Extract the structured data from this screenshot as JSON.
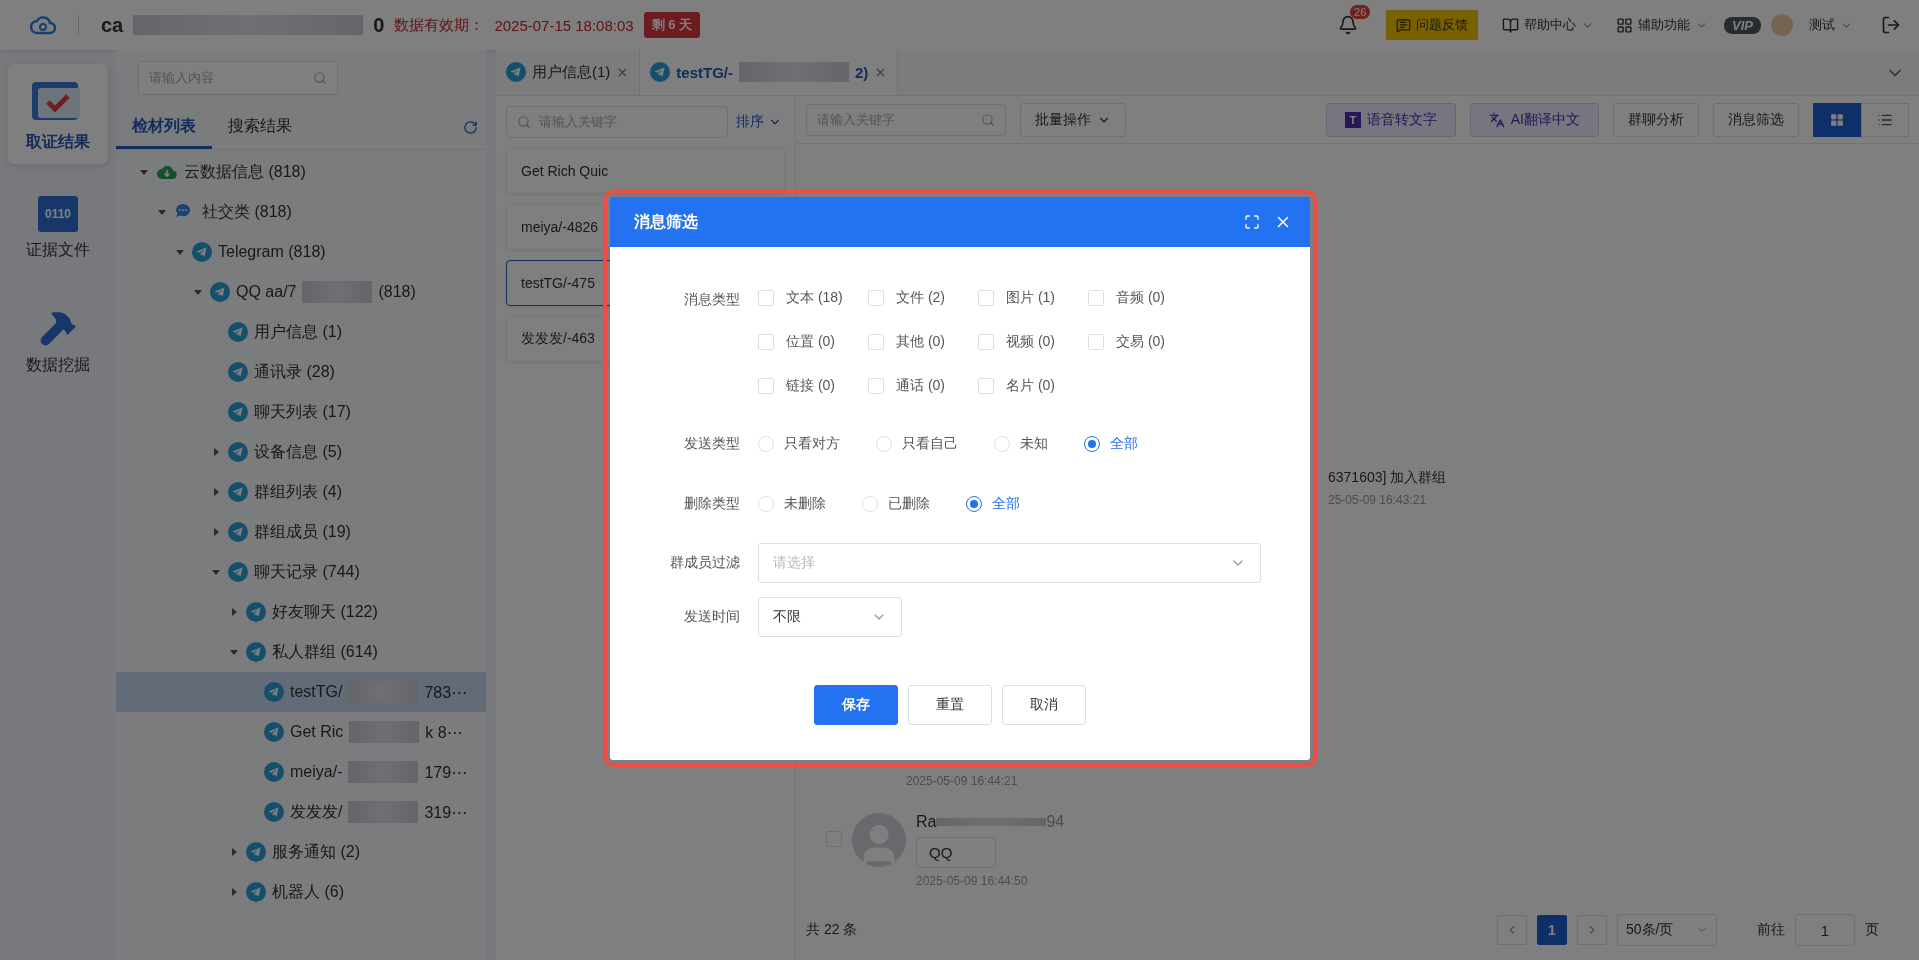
{
  "header": {
    "title": "ca",
    "title_end": "0",
    "validity_label": "数据有效期：",
    "validity_date": "2025-07-15 18:08:03",
    "remaining": "剩 6 天",
    "notifications": "26",
    "feedback": "问题反馈",
    "menus": [
      {
        "kind": "help",
        "label": "帮助中心"
      },
      {
        "kind": "tools",
        "label": "辅助功能"
      }
    ],
    "vip": "VIP",
    "user": "测试"
  },
  "nav": [
    {
      "kind": "folder",
      "label": "取证结果",
      "selected": true
    },
    {
      "kind": "file",
      "label": "证据文件",
      "icon_text": "0110",
      "selected": false
    },
    {
      "kind": "hammer",
      "label": "数据挖掘",
      "selected": false
    }
  ],
  "tree": {
    "search_placeholder": "请输入内容",
    "tabs": [
      {
        "label": "检材列表",
        "selected": true
      },
      {
        "label": "搜索结果",
        "selected": false
      }
    ],
    "items": [
      {
        "kind": "cloud",
        "label": "云数据信息 (818)",
        "expanded": true,
        "selected": false,
        "children": [
          {
            "kind": "chat",
            "label": "社交类 (818)",
            "expanded": true,
            "selected": false,
            "children": [
              {
                "kind": "telegram",
                "label": "Telegram (818)",
                "expanded": true,
                "selected": false,
                "children": [
                  {
                    "kind": "telegram",
                    "label": "QQ aa/7",
                    "suffix": "(818)",
                    "expanded": true,
                    "selected": false,
                    "children": [
                      {
                        "kind": "telegram",
                        "label": "用户信息 (1)",
                        "selected": false
                      },
                      {
                        "kind": "telegram",
                        "label": "通讯录 (28)",
                        "selected": false
                      },
                      {
                        "kind": "telegram",
                        "label": "聊天列表 (17)",
                        "selected": false
                      },
                      {
                        "kind": "telegram",
                        "label": "设备信息 (5)",
                        "expanded": false,
                        "selected": false
                      },
                      {
                        "kind": "telegram",
                        "label": "群组列表 (4)",
                        "expanded": false,
                        "selected": false
                      },
                      {
                        "kind": "telegram",
                        "label": "群组成员 (19)",
                        "expanded": false,
                        "selected": false
                      },
                      {
                        "kind": "telegram",
                        "label": "聊天记录 (744)",
                        "expanded": true,
                        "selected": false,
                        "children": [
                          {
                            "kind": "telegram",
                            "label": "好友聊天 (122)",
                            "expanded": false,
                            "selected": false
                          },
                          {
                            "kind": "telegram",
                            "label": "私人群组 (614)",
                            "expanded": true,
                            "selected": false,
                            "children": [
                              {
                                "kind": "telegram",
                                "label": "testTG/",
                                "suffix": "783⋯",
                                "selected": true
                              },
                              {
                                "kind": "telegram",
                                "label": "Get Ric",
                                "suffix": "k 8⋯",
                                "selected": false
                              },
                              {
                                "kind": "telegram",
                                "label": "meiya/-",
                                "suffix": "179⋯",
                                "selected": false
                              },
                              {
                                "kind": "telegram",
                                "label": "发发发/",
                                "suffix": "319⋯",
                                "selected": false
                              }
                            ]
                          },
                          {
                            "kind": "telegram",
                            "label": "服务通知 (2)",
                            "expanded": false,
                            "selected": false
                          },
                          {
                            "kind": "telegram",
                            "label": "机器人 (6)",
                            "expanded": false,
                            "selected": false
                          }
                        ]
                      }
                    ]
                  }
                ]
              }
            ]
          }
        ]
      }
    ]
  },
  "doc_tabs": [
    {
      "label": "用户信息(1)",
      "selected": false
    },
    {
      "label": "testTG/-",
      "suffix": "2)",
      "selected": true
    }
  ],
  "chat_list": {
    "search_placeholder": "请输入关键字",
    "sort": "排序",
    "items": [
      {
        "label": "Get Rich Quic",
        "selected": false
      },
      {
        "label": "meiya/-4826",
        "selected": false
      },
      {
        "label": "testTG/-475",
        "selected": true
      },
      {
        "label": "发发发/-463",
        "selected": false
      }
    ]
  },
  "messages": {
    "search_placeholder": "请输入关键字",
    "batch": "批量操作",
    "tools": [
      {
        "kind": "voice",
        "label": "语音转文字",
        "icon_text": "T"
      },
      {
        "kind": "translate",
        "label": "AI翻译中文"
      },
      {
        "kind": "plain",
        "label": "群聊分析"
      },
      {
        "kind": "plain",
        "label": "消息筛选"
      }
    ],
    "views": [
      {
        "kind": "grid",
        "selected": true
      },
      {
        "kind": "list",
        "selected": false
      }
    ],
    "items": [
      {
        "kind": "system",
        "text": "6371603] 加入群组",
        "time": "25-05-09 16:43:21"
      },
      {
        "kind": "time",
        "time": "2025-05-09 16:44:21"
      },
      {
        "kind": "message",
        "name": "Ra",
        "name_end": "94",
        "text": "QQ",
        "time": "2025-05-09 16:44:50",
        "checked": false
      }
    ],
    "total": "共 22 条",
    "pages": [
      {
        "label": "1",
        "selected": true
      }
    ],
    "page_size": "50条/页",
    "goto_label": "前往",
    "goto_value": "1",
    "page_unit": "页"
  },
  "dialog": {
    "title": "消息筛选",
    "message_types": {
      "label": "消息类型",
      "options": [
        {
          "label": "文本 (18)",
          "checked": false
        },
        {
          "label": "文件 (2)",
          "checked": false
        },
        {
          "label": "图片 (1)",
          "checked": false
        },
        {
          "label": "音频 (0)",
          "checked": false
        },
        {
          "label": "位置 (0)",
          "checked": false
        },
        {
          "label": "其他 (0)",
          "checked": false
        },
        {
          "label": "视频 (0)",
          "checked": false
        },
        {
          "label": "交易 (0)",
          "checked": false
        },
        {
          "label": "链接 (0)",
          "checked": false
        },
        {
          "label": "通话 (0)",
          "checked": false
        },
        {
          "label": "名片 (0)",
          "checked": false
        }
      ]
    },
    "send_type": {
      "label": "发送类型",
      "options": [
        {
          "label": "只看对方",
          "selected": false
        },
        {
          "label": "只看自己",
          "selected": false
        },
        {
          "label": "未知",
          "selected": false
        },
        {
          "label": "全部",
          "selected": true
        }
      ]
    },
    "delete_type": {
      "label": "删除类型",
      "options": [
        {
          "label": "未删除",
          "selected": false
        },
        {
          "label": "已删除",
          "selected": false
        },
        {
          "label": "全部",
          "selected": true
        }
      ]
    },
    "member_filter": {
      "label": "群成员过滤",
      "placeholder": "请选择"
    },
    "send_time": {
      "label": "发送时间",
      "value": "不限"
    },
    "buttons": [
      {
        "label": "保存",
        "kind": "primary"
      },
      {
        "label": "重置",
        "kind": "default"
      },
      {
        "label": "取消",
        "kind": "default"
      }
    ]
  }
}
